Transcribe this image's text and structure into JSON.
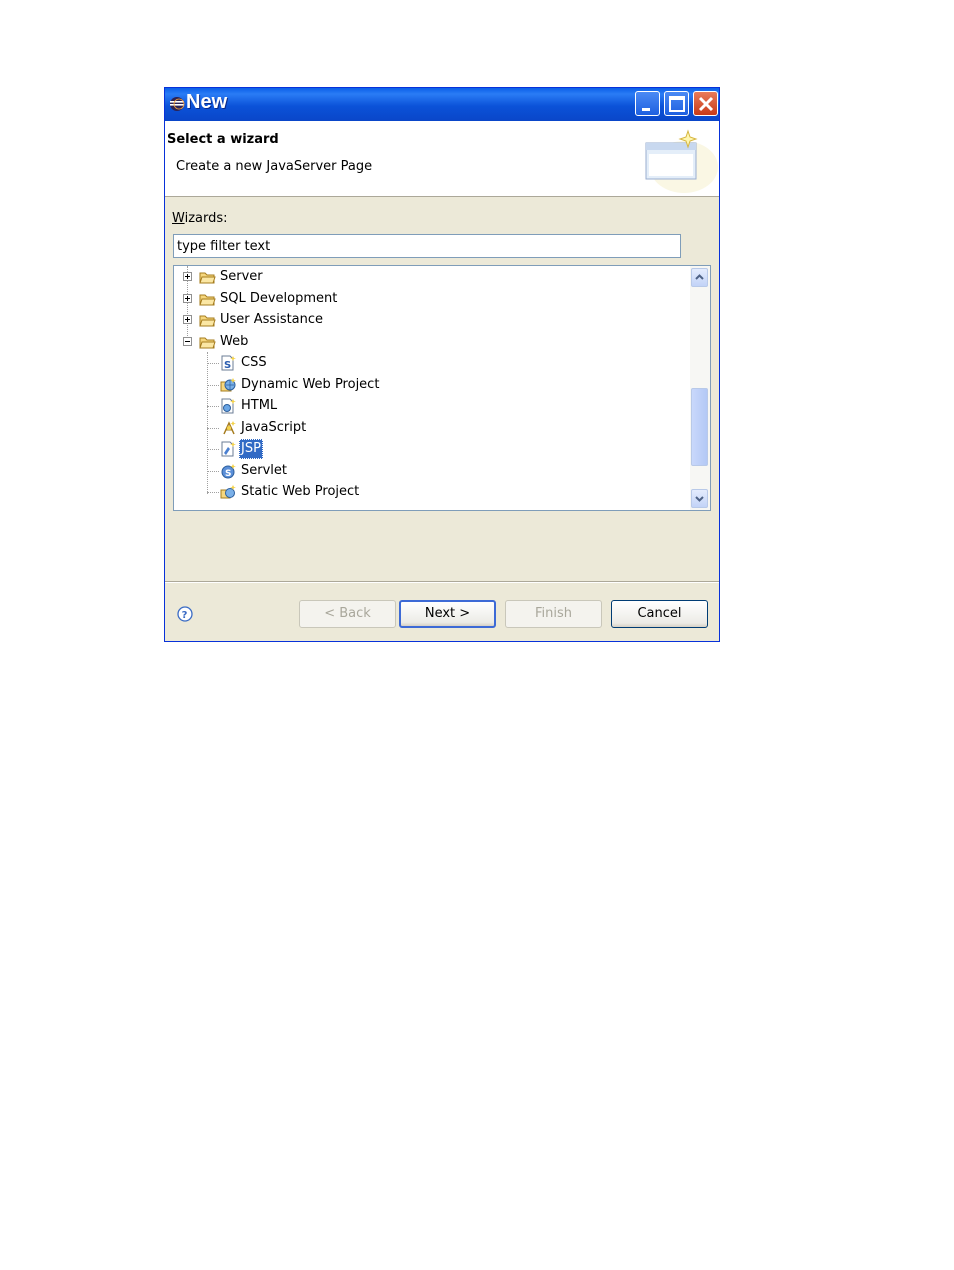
{
  "window": {
    "title": "New"
  },
  "banner": {
    "title": "Select a wizard",
    "description": "Create a new JavaServer Page"
  },
  "wizards": {
    "label_mnemonic": "W",
    "label_rest": "izards:",
    "filter_value": "type filter text"
  },
  "tree": {
    "items": [
      {
        "label": "Server",
        "icon": "folder-icon",
        "expander": "plus"
      },
      {
        "label": "SQL Development",
        "icon": "folder-icon",
        "expander": "plus"
      },
      {
        "label": "User Assistance",
        "icon": "folder-icon",
        "expander": "plus"
      },
      {
        "label": "Web",
        "icon": "folder-open-icon",
        "expander": "minus"
      },
      {
        "label": "CSS",
        "icon": "css-file-icon"
      },
      {
        "label": "Dynamic Web Project",
        "icon": "dynamic-web-project-icon"
      },
      {
        "label": "HTML",
        "icon": "html-file-icon"
      },
      {
        "label": "JavaScript",
        "icon": "javascript-file-icon"
      },
      {
        "label": "JSP",
        "icon": "jsp-file-icon",
        "selected": true
      },
      {
        "label": "Servlet",
        "icon": "servlet-icon"
      },
      {
        "label": "Static Web Project",
        "icon": "static-web-project-icon"
      }
    ]
  },
  "buttons": {
    "back": "< Back",
    "next": "Next >",
    "finish": "Finish",
    "cancel": "Cancel"
  },
  "colors": {
    "titlebar": "#0a52d8",
    "selection": "#316ac5",
    "dialog_bg": "#ece9d8"
  }
}
